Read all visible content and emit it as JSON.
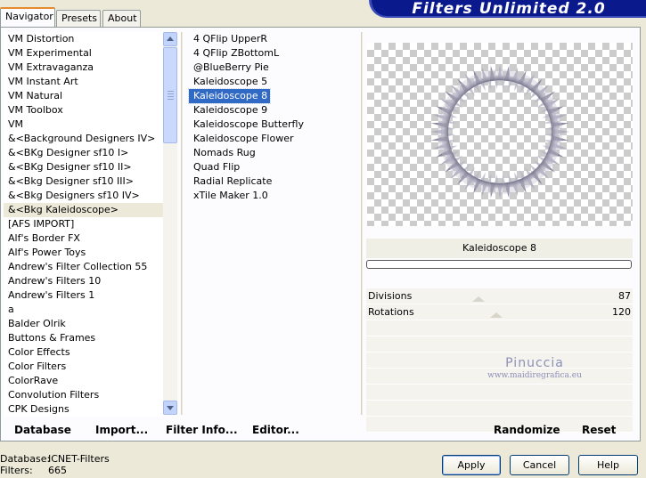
{
  "tabs": [
    {
      "label": "Navigator",
      "active": true
    },
    {
      "label": "Presets",
      "active": false
    },
    {
      "label": "About",
      "active": false
    }
  ],
  "banner": {
    "title": "Filters Unlimited 2.0"
  },
  "categories": [
    "VM Distortion",
    "VM Experimental",
    "VM Extravaganza",
    "VM Instant Art",
    "VM Natural",
    "VM Toolbox",
    "VM",
    "&<Background Designers IV>",
    "&<BKg Designer sf10 I>",
    "&<BKg Designer sf10 II>",
    "&<Bkg Designer sf10 III>",
    "&<Bkg Designers sf10 IV>",
    "&<Bkg Kaleidoscope>",
    "[AFS IMPORT]",
    "Alf's Border FX",
    "Alf's Power Toys",
    "Andrew's Filter Collection 55",
    "Andrew's Filters 10",
    "Andrew's Filters 1",
    "a",
    "Balder Olrik",
    "Buttons & Frames",
    "Color Effects",
    "Color Filters",
    "ColorRave",
    "Convolution Filters",
    "CPK Designs"
  ],
  "selected_category": "&<Bkg Kaleidoscope>",
  "filters": [
    "4 QFlip UpperR",
    "4 QFlip ZBottomL",
    "@BlueBerry Pie",
    "Kaleidoscope 5",
    "Kaleidoscope 8",
    "Kaleidoscope 9",
    "Kaleidoscope Butterfly",
    "Kaleidoscope Flower",
    "Nomads Rug",
    "Quad Flip",
    "Radial Replicate",
    "xTile Maker 1.0"
  ],
  "selected_filter": "Kaleidoscope 8",
  "preview": {
    "filter_name": "Kaleidoscope 8"
  },
  "params": [
    {
      "label": "Divisions",
      "value": "87",
      "level": 0.34
    },
    {
      "label": "Rotations",
      "value": "120",
      "level": 0.47
    }
  ],
  "watermark": {
    "title": "Pinuccia",
    "url": "www.maidiregrafica.eu"
  },
  "bottom_links": {
    "database": "Database",
    "import": "Import...",
    "filter_info": "Filter Info...",
    "editor": "Editor...",
    "randomize": "Randomize",
    "reset": "Reset"
  },
  "status": {
    "database_label": "Database:",
    "database_value": "ICNET-Filters",
    "filters_label": "Filters:",
    "filters_value": "665"
  },
  "buttons": {
    "apply": "Apply",
    "cancel": "Cancel",
    "help": "Help"
  },
  "colors": {
    "selection": "#316ac5",
    "banner": "#0a1a8c",
    "watermark": "#8d8fb7"
  }
}
